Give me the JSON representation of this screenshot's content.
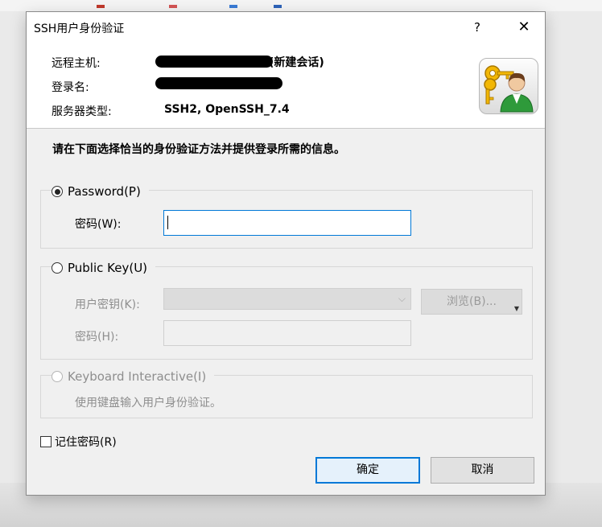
{
  "dialog": {
    "title": "SSH用户身份验证",
    "help_glyph": "?",
    "close_glyph": "✕"
  },
  "header": {
    "remote_host_label": "远程主机:",
    "remote_host_suffix": "(新建会话)",
    "login_label": "登录名:",
    "server_type_label": "服务器类型:",
    "server_type_value": "SSH2, OpenSSH_7.4",
    "logo_icon": "user-key-icon"
  },
  "instruction": "请在下面选择恰当的身份验证方法并提供登录所需的信息。",
  "password_group": {
    "label": "Password(P)",
    "selected": true,
    "password_label": "密码(W):",
    "password_value": ""
  },
  "public_key_group": {
    "label": "Public Key(U)",
    "selected": false,
    "user_key_label": "用户密钥(K):",
    "browse_label": "浏览(B)...",
    "passphrase_label": "密码(H):"
  },
  "keyboard_group": {
    "label": "Keyboard Interactive(I)",
    "selected": false,
    "description": "使用键盘输入用户身份验证。"
  },
  "remember_password": {
    "label": "记住密码(R)",
    "checked": false
  },
  "buttons": {
    "ok_label": "确定",
    "cancel_label": "取消"
  },
  "colors": {
    "focus_blue": "#0078d7",
    "dialog_bg": "#f0f0f0",
    "disabled_text": "#8e8e8e"
  }
}
